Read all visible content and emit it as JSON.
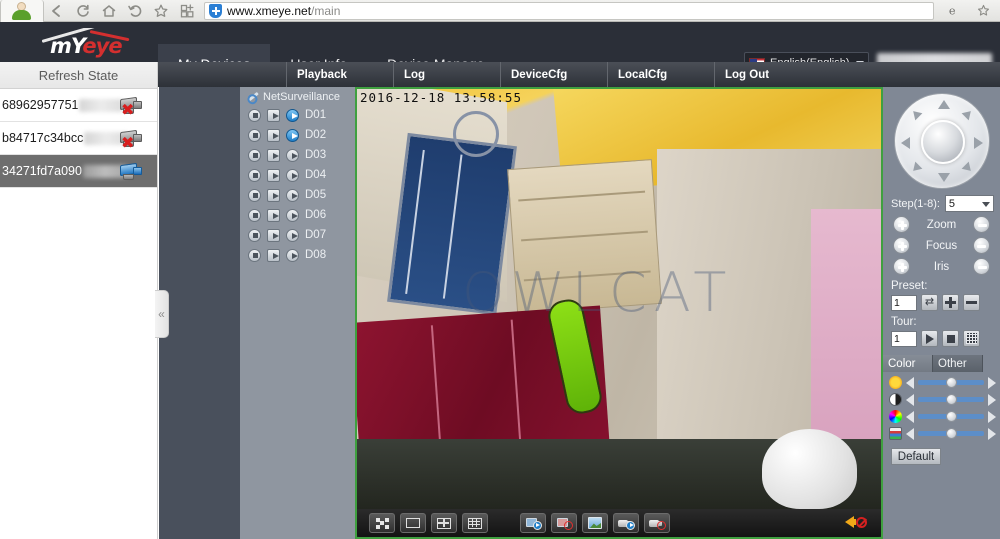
{
  "browser": {
    "url_host": "www.xmeye.net",
    "url_path": "/main",
    "icons": [
      "back-icon",
      "reload-icon",
      "home-icon",
      "undo-icon",
      "favorite-icon",
      "apps-icon",
      "shield-icon",
      "ie-engine-icon",
      "bookmark-star-icon"
    ],
    "avatar_label": "user-avatar"
  },
  "header": {
    "logo_prefix": "mY",
    "logo_suffix": "eye",
    "nav": [
      {
        "label": "My Devices",
        "active": true
      },
      {
        "label": "User Info",
        "active": false
      },
      {
        "label": "Device Manage",
        "active": false
      }
    ],
    "language": "English(English)"
  },
  "subnav": {
    "items": [
      "Playback",
      "Log",
      "DeviceCfg",
      "LocalCfg",
      "Log Out"
    ]
  },
  "left_panel": {
    "refresh_label": "Refresh State",
    "devices": [
      {
        "name": "68962957751",
        "online": false,
        "selected": false
      },
      {
        "name": "b84717c34bcc",
        "online": false,
        "selected": false
      },
      {
        "name": "34271fd7a090",
        "online": true,
        "selected": true
      }
    ],
    "collapse_glyph": "«"
  },
  "tree": {
    "root": "NetSurveillance",
    "channels": [
      {
        "label": "D01",
        "streaming": true
      },
      {
        "label": "D02",
        "streaming": true
      },
      {
        "label": "D03",
        "streaming": false
      },
      {
        "label": "D04",
        "streaming": false
      },
      {
        "label": "D05",
        "streaming": false
      },
      {
        "label": "D06",
        "streaming": false
      },
      {
        "label": "D07",
        "streaming": false
      },
      {
        "label": "D08",
        "streaming": false
      }
    ]
  },
  "video": {
    "timestamp": "2016-12-18  13:58:55",
    "watermark": "OWLCAT",
    "toolbar": [
      {
        "name": "fullscreen-button",
        "icon": "fullscreen-icon"
      },
      {
        "name": "single-view-button",
        "icon": "layout-1x1-icon"
      },
      {
        "name": "quad-view-button",
        "icon": "layout-2x2-icon"
      },
      {
        "name": "nine-view-button",
        "icon": "layout-3x3-icon"
      },
      {
        "name": "start-all-playback-button",
        "icon": "monitor-play-icon"
      },
      {
        "name": "stop-all-playback-button",
        "icon": "monitor-stop-icon"
      },
      {
        "name": "snapshot-button",
        "icon": "picture-icon"
      },
      {
        "name": "start-record-button",
        "icon": "camera-play-icon"
      },
      {
        "name": "stop-record-button",
        "icon": "camera-stop-icon"
      }
    ],
    "mute_label": "mute-icon"
  },
  "ptz": {
    "step_label": "Step(1-8):",
    "step_value": "5",
    "controls": [
      {
        "label": "Zoom"
      },
      {
        "label": "Focus"
      },
      {
        "label": "Iris"
      }
    ],
    "preset_label": "Preset:",
    "preset_value": "1",
    "tour_label": "Tour:",
    "tour_value": "1"
  },
  "color": {
    "tabs": [
      {
        "label": "Color",
        "active": true
      },
      {
        "label": "Other",
        "active": false
      }
    ],
    "sliders": [
      {
        "name": "brightness",
        "icon": "sun-icon",
        "value": 50
      },
      {
        "name": "contrast",
        "icon": "contrast-icon",
        "value": 50
      },
      {
        "name": "hue",
        "icon": "color-wheel-icon",
        "value": 50
      },
      {
        "name": "saturation",
        "icon": "palette-icon",
        "value": 50
      }
    ],
    "default_label": "Default"
  }
}
